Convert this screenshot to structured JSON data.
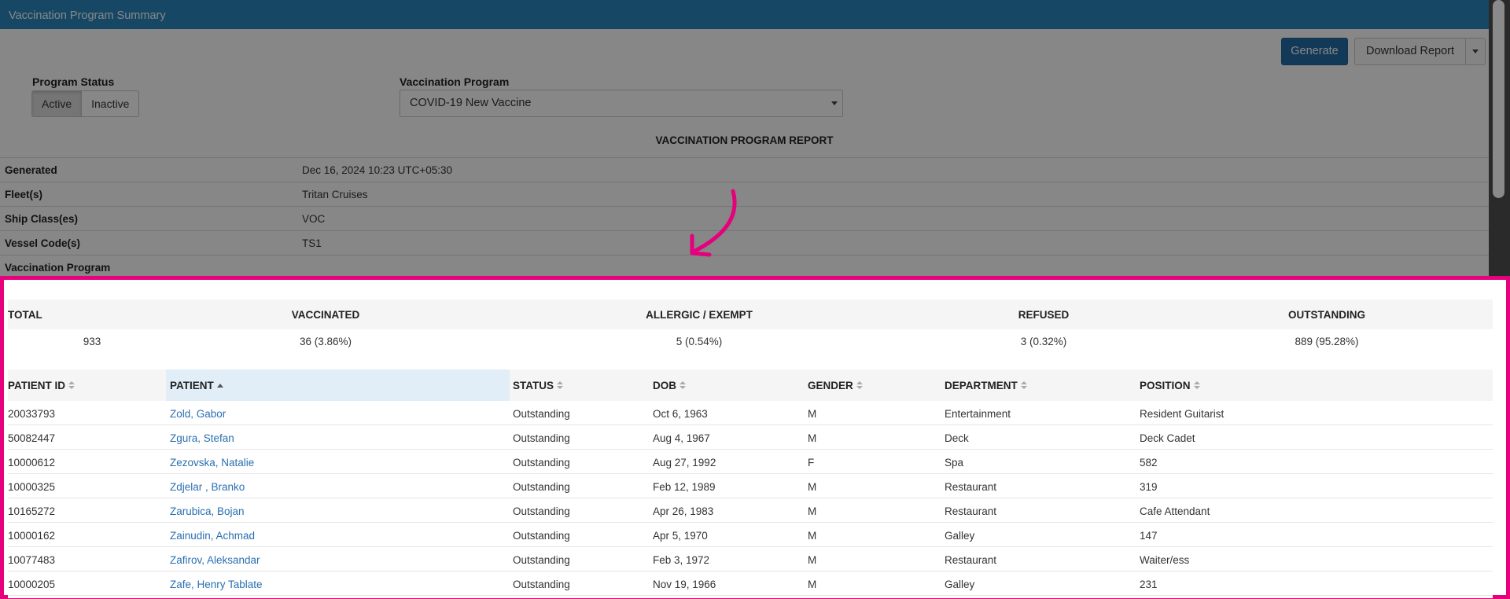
{
  "header": {
    "title": "Vaccination Program Summary"
  },
  "toolbar": {
    "generate_label": "Generate",
    "download_label": "Download Report"
  },
  "filters": {
    "program_status_label": "Program Status",
    "status_options": [
      "Active",
      "Inactive"
    ],
    "status_selected": "Active",
    "vaccination_program_label": "Vaccination Program",
    "vaccination_program_value": "COVID-19 New Vaccine"
  },
  "report": {
    "title": "VACCINATION PROGRAM REPORT",
    "meta": [
      {
        "key": "Generated",
        "value": "Dec 16, 2024 10:23 UTC+05:30"
      },
      {
        "key": "Fleet(s)",
        "value": "Tritan Cruises"
      },
      {
        "key": "Ship Class(es)",
        "value": "VOC"
      },
      {
        "key": "Vessel Code(s)",
        "value": "TS1"
      },
      {
        "key": "Vaccination Program",
        "value": ""
      }
    ]
  },
  "summary": {
    "headers": [
      "TOTAL",
      "VACCINATED",
      "ALLERGIC / EXEMPT",
      "REFUSED",
      "OUTSTANDING"
    ],
    "values": [
      "933",
      "36 (3.86%)",
      "5 (0.54%)",
      "3 (0.32%)",
      "889 (95.28%)"
    ]
  },
  "table": {
    "columns": [
      "PATIENT ID",
      "PATIENT",
      "STATUS",
      "DOB",
      "GENDER",
      "DEPARTMENT",
      "POSITION"
    ],
    "sorted_column": "PATIENT",
    "rows": [
      [
        "20033793",
        "Zold, Gabor",
        "Outstanding",
        "Oct 6, 1963",
        "M",
        "Entertainment",
        "Resident Guitarist"
      ],
      [
        "50082447",
        "Zgura, Stefan",
        "Outstanding",
        "Aug 4, 1967",
        "M",
        "Deck",
        "Deck Cadet"
      ],
      [
        "10000612",
        "Zezovska, Natalie",
        "Outstanding",
        "Aug 27, 1992",
        "F",
        "Spa",
        "582"
      ],
      [
        "10000325",
        "Zdjelar , Branko",
        "Outstanding",
        "Feb 12, 1989",
        "M",
        "Restaurant",
        "319"
      ],
      [
        "10165272",
        "Zarubica, Bojan",
        "Outstanding",
        "Apr 26, 1983",
        "M",
        "Restaurant",
        "Cafe Attendant"
      ],
      [
        "10000162",
        "Zainudin, Achmad",
        "Outstanding",
        "Apr 5, 1970",
        "M",
        "Galley",
        "147"
      ],
      [
        "10077483",
        "Zafirov, Aleksandar",
        "Outstanding",
        "Feb 3, 1972",
        "M",
        "Restaurant",
        "Waiter/ess"
      ],
      [
        "10000205",
        "Zafe, Henry Tablate",
        "Outstanding",
        "Nov 19, 1966",
        "M",
        "Galley",
        "231"
      ]
    ]
  },
  "colors": {
    "header_blue": "#2a88c1",
    "button_blue": "#236fa6",
    "highlight": "#e6007e",
    "link": "#2a6fb0"
  },
  "icons": [
    "dropdown-caret-icon",
    "sort-icon",
    "sort-ascending-icon",
    "annotation-arrow"
  ]
}
